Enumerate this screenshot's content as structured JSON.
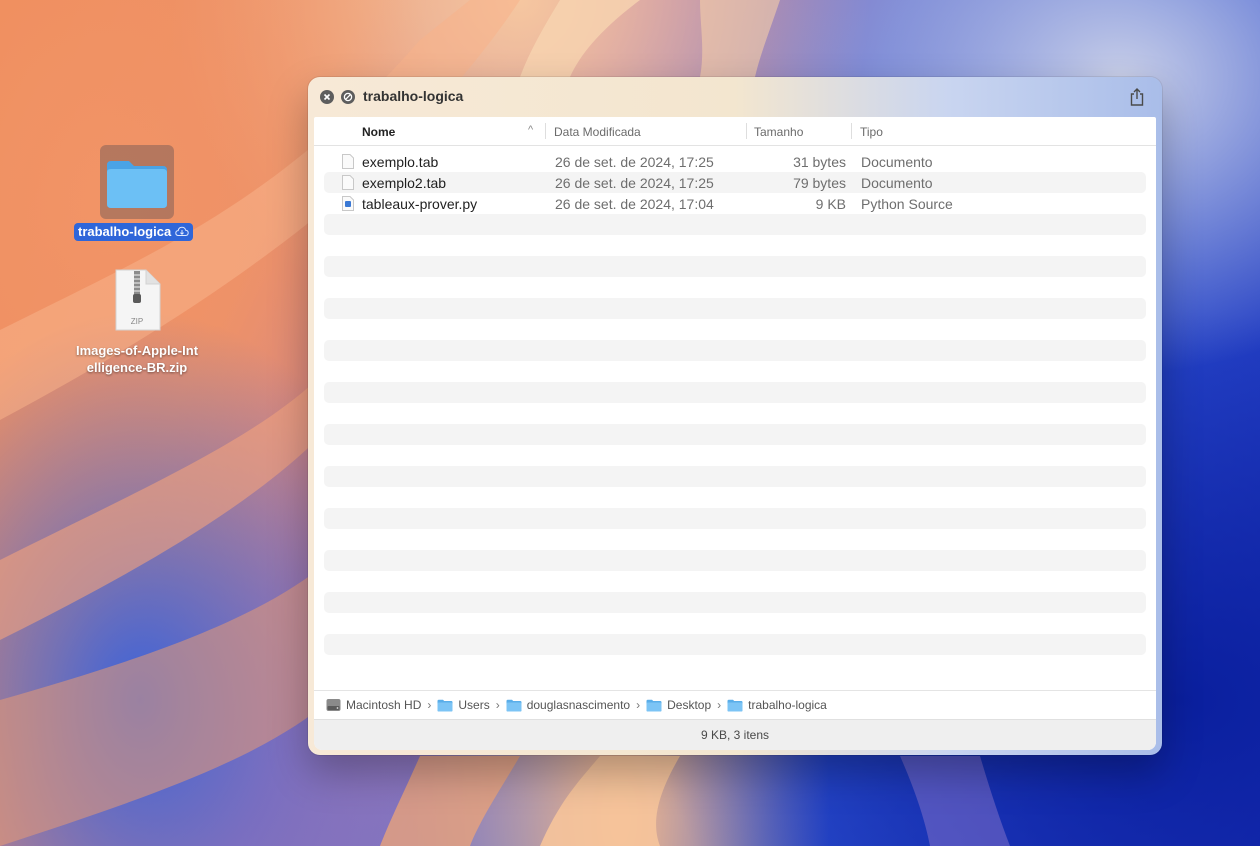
{
  "desktop": {
    "items": [
      {
        "label": "trabalho-logica",
        "kind": "folder",
        "selected": true,
        "icon": "folder-icon",
        "badge_icon": "icloud-download-icon"
      },
      {
        "label": "Images-of-Apple-Intelligence-BR.zip",
        "kind": "zip",
        "selected": false,
        "icon": "zip-archive-icon",
        "icon_text": "ZIP"
      }
    ]
  },
  "window": {
    "title": "trabalho-logica",
    "buttons": {
      "close_icon": "close-icon",
      "minimize_icon": "disabled-icon",
      "share_icon": "share-icon"
    },
    "columns": [
      {
        "label": "Nome",
        "sorted": true,
        "sort_indicator": "^"
      },
      {
        "label": "Data Modificada"
      },
      {
        "label": "Tamanho"
      },
      {
        "label": "Tipo"
      }
    ],
    "files": [
      {
        "name": "exemplo.tab",
        "date": "26 de set. de 2024, 17:25",
        "size": "31 bytes",
        "type": "Documento",
        "icon": "document-icon"
      },
      {
        "name": "exemplo2.tab",
        "date": "26 de set. de 2024, 17:25",
        "size": "79 bytes",
        "type": "Documento",
        "icon": "document-icon"
      },
      {
        "name": "tableaux-prover.py",
        "date": "26 de set. de 2024, 17:04",
        "size": "9 KB",
        "type": "Python Source",
        "icon": "python-file-icon"
      }
    ],
    "path": [
      "Macintosh HD",
      "Users",
      "douglasnascimento",
      "Desktop",
      "trabalho-logica"
    ],
    "status": "9 KB, 3 itens"
  },
  "colors": {
    "selection": "#2f66d9",
    "folder": "#5fb4f0",
    "row_stripe": "#f4f4f4"
  }
}
